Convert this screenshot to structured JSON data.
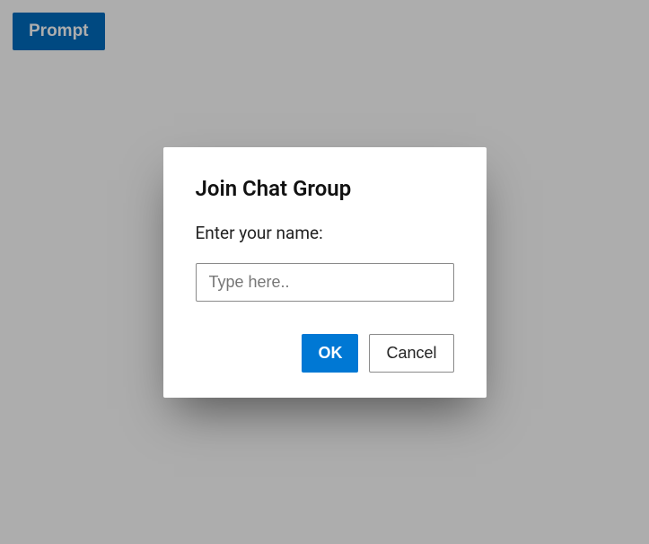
{
  "toolbar": {
    "prompt_label": "Prompt"
  },
  "dialog": {
    "title": "Join Chat Group",
    "label": "Enter your name:",
    "placeholder": "Type here..",
    "ok_label": "OK",
    "cancel_label": "Cancel"
  }
}
